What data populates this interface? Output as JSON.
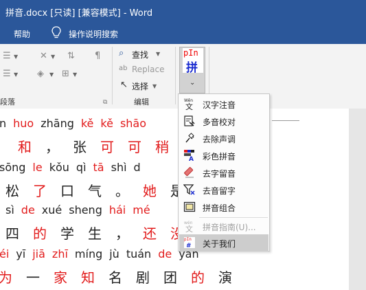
{
  "window": {
    "title": "拼音.docx [只读] [兼容模式]  -  Word"
  },
  "menubar": {
    "help": "帮助",
    "tell_me": "操作说明搜索"
  },
  "ribbon": {
    "paragraph_label": "段落",
    "editing_label": "编辑",
    "find": "查找",
    "replace": "Replace",
    "select": "选择",
    "pinyin_button": {
      "pinyin": "pIn",
      "hanzi": "拼"
    }
  },
  "dropdown": {
    "items": [
      {
        "label": "汉字注音",
        "icon": "hanzi-annotate-icon",
        "enabled": true
      },
      {
        "label": "多音校对",
        "icon": "polyphone-check-icon",
        "enabled": true
      },
      {
        "label": "去除声调",
        "icon": "remove-tone-icon",
        "enabled": true
      },
      {
        "label": "彩色拼音",
        "icon": "color-pinyin-icon",
        "enabled": true
      },
      {
        "label": "去字留音",
        "icon": "eraser-icon",
        "enabled": true
      },
      {
        "label": "去音留字",
        "icon": "filter-icon",
        "enabled": true
      },
      {
        "label": "拼音组合",
        "icon": "pinyin-combine-icon",
        "enabled": true
      },
      {
        "label": "拼音指南(U)...",
        "icon": "pinyin-guide-icon",
        "enabled": false
      },
      {
        "label": "关于我们",
        "icon": "pin-logo-icon",
        "enabled": true,
        "highlighted": true
      }
    ]
  },
  "document": {
    "lines": [
      {
        "type": "pinyin",
        "words": [
          {
            "t": "n",
            "c": "blk"
          },
          {
            "t": "huo",
            "c": "red"
          },
          {
            "t": "zhāng",
            "c": "blk"
          },
          {
            "t": "kě",
            "c": "red"
          },
          {
            "t": "kě",
            "c": "red"
          },
          {
            "t": "shāo",
            "c": "red"
          }
        ]
      },
      {
        "type": "hanzi",
        "words": [
          {
            "t": "",
            "c": "blk"
          },
          {
            "t": "和",
            "c": "red"
          },
          {
            "t": "，",
            "c": "blk"
          },
          {
            "t": "张",
            "c": "blk"
          },
          {
            "t": "可",
            "c": "red"
          },
          {
            "t": "可",
            "c": "red"
          },
          {
            "t": "稍",
            "c": "red"
          }
        ]
      },
      {
        "type": "pinyin",
        "words": [
          {
            "t": "sōng",
            "c": "blk"
          },
          {
            "t": "le",
            "c": "red"
          },
          {
            "t": "kǒu",
            "c": "blk"
          },
          {
            "t": "qì",
            "c": "blk"
          },
          {
            "t": "tā",
            "c": "red"
          },
          {
            "t": "shì",
            "c": "blk"
          },
          {
            "t": "d",
            "c": "blk"
          }
        ]
      },
      {
        "type": "hanzi",
        "words": [
          {
            "t": "松",
            "c": "blk"
          },
          {
            "t": "了",
            "c": "red"
          },
          {
            "t": "口",
            "c": "blk"
          },
          {
            "t": "气",
            "c": "blk"
          },
          {
            "t": "。",
            "c": "blk"
          },
          {
            "t": "她",
            "c": "red"
          },
          {
            "t": "是",
            "c": "blk"
          }
        ]
      },
      {
        "type": "pinyin",
        "words": [
          {
            "t": "sì",
            "c": "blk"
          },
          {
            "t": "de",
            "c": "red"
          },
          {
            "t": "xué",
            "c": "blk"
          },
          {
            "t": "sheng",
            "c": "blk"
          },
          {
            "t": "hái",
            "c": "red"
          },
          {
            "t": "mé",
            "c": "red"
          }
        ]
      },
      {
        "type": "hanzi",
        "words": [
          {
            "t": "四",
            "c": "blk"
          },
          {
            "t": "的",
            "c": "red"
          },
          {
            "t": "学",
            "c": "blk"
          },
          {
            "t": "生",
            "c": "blk"
          },
          {
            "t": "，",
            "c": "blk"
          },
          {
            "t": "还",
            "c": "red"
          },
          {
            "t": "没",
            "c": "red"
          }
        ]
      },
      {
        "type": "pinyin",
        "words": [
          {
            "t": "éi",
            "c": "red"
          },
          {
            "t": "yī",
            "c": "blk"
          },
          {
            "t": "jiā",
            "c": "red"
          },
          {
            "t": "zhī",
            "c": "red"
          },
          {
            "t": "míng",
            "c": "blk"
          },
          {
            "t": "jù",
            "c": "blk"
          },
          {
            "t": "tuán",
            "c": "blk"
          },
          {
            "t": "de",
            "c": "red"
          },
          {
            "t": "yǎn",
            "c": "blk"
          }
        ]
      },
      {
        "type": "hanzi",
        "words": [
          {
            "t": "为",
            "c": "red"
          },
          {
            "t": "一",
            "c": "blk"
          },
          {
            "t": "家",
            "c": "red"
          },
          {
            "t": "知",
            "c": "red"
          },
          {
            "t": "名",
            "c": "blk"
          },
          {
            "t": "剧",
            "c": "blk"
          },
          {
            "t": "团",
            "c": "blk"
          },
          {
            "t": "的",
            "c": "red"
          },
          {
            "t": "演",
            "c": "blk"
          }
        ]
      }
    ]
  },
  "colors": {
    "title_bar": "#2b579a",
    "pinyin_red": "#e21b1b",
    "pinyin_blue": "#1a2bd0"
  }
}
